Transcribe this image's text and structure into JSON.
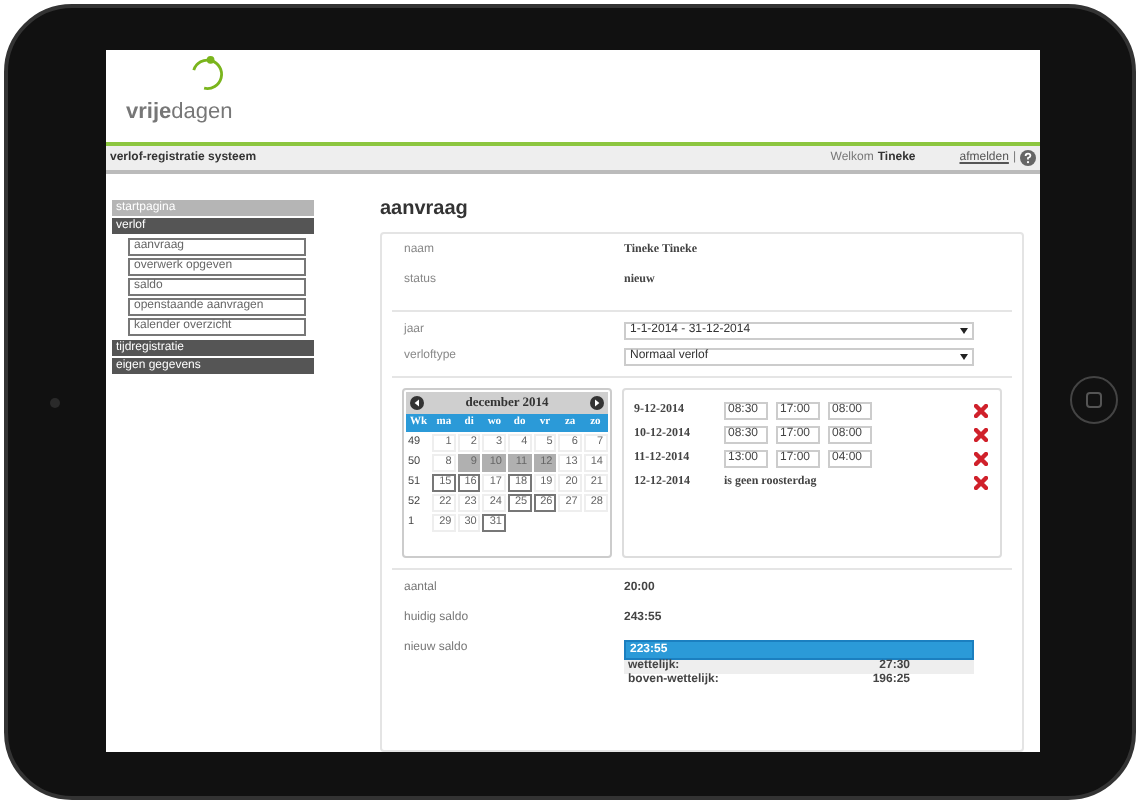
{
  "logo": "**vrije**dagen",
  "topbar": {
    "title": "verlof-registratie systeem",
    "welcome": "Welkom",
    "user": "Tineke",
    "logout": "afmelden",
    "separator": "|"
  },
  "sidebar": [
    {
      "label": "startpagina",
      "selected": true
    },
    {
      "label": "verlof",
      "selected": false,
      "expanded": true,
      "children": [
        {
          "label": "aanvraag"
        },
        {
          "label": "overwerk opgeven"
        },
        {
          "label": "saldo"
        },
        {
          "label": "openstaande aanvragen"
        },
        {
          "label": "kalender overzicht"
        }
      ]
    },
    {
      "label": "tijdregistratie",
      "selected": false
    },
    {
      "label": "eigen gegevens",
      "selected": false
    }
  ],
  "page_title": "aanvraag",
  "info": [
    {
      "label": "naam",
      "value": "Tineke Tineke"
    },
    {
      "label": "status",
      "value": "nieuw"
    }
  ],
  "selects": [
    {
      "label": "jaar",
      "value": "1-1-2014 - 31-12-2014"
    },
    {
      "label": "verloftype",
      "value": "Normaal verlof"
    }
  ],
  "calendar": {
    "month": "december 2014",
    "headers": [
      "Wk",
      "ma",
      "di",
      "wo",
      "do",
      "vr",
      "za",
      "zo"
    ],
    "weeks": [
      {
        "week": "49",
        "days": [
          {
            "day": "1"
          },
          {
            "day": "2"
          },
          {
            "day": "3"
          },
          {
            "day": "4"
          },
          {
            "day": "5"
          },
          {
            "day": "6"
          },
          {
            "day": "7"
          }
        ]
      },
      {
        "week": "50",
        "days": [
          {
            "day": "8"
          },
          {
            "day": "9",
            "selected": true
          },
          {
            "day": "10",
            "selected": true
          },
          {
            "day": "11",
            "selected": true
          },
          {
            "day": "12",
            "selected": true
          },
          {
            "day": "13"
          },
          {
            "day": "14"
          }
        ]
      },
      {
        "week": "51",
        "days": [
          {
            "day": "15",
            "outlined": true
          },
          {
            "day": "16",
            "outlined": true
          },
          {
            "day": "17"
          },
          {
            "day": "18",
            "outlined": true
          },
          {
            "day": "19"
          },
          {
            "day": "20"
          },
          {
            "day": "21"
          }
        ]
      },
      {
        "week": "52",
        "days": [
          {
            "day": "22"
          },
          {
            "day": "23"
          },
          {
            "day": "24"
          },
          {
            "day": "25",
            "outlined": true
          },
          {
            "day": "26",
            "outlined": true
          },
          {
            "day": "27"
          },
          {
            "day": "28"
          }
        ]
      },
      {
        "week": "1",
        "days": [
          {
            "day": "29"
          },
          {
            "day": "30"
          },
          {
            "day": "31",
            "outlined": true
          }
        ]
      }
    ]
  },
  "entries": [
    {
      "kind": "times",
      "date": "9-12-2014",
      "start": "08:30",
      "end": "17:00",
      "hours": "08:00"
    },
    {
      "kind": "times",
      "date": "10-12-2014",
      "start": "08:30",
      "end": "17:00",
      "hours": "08:00"
    },
    {
      "kind": "times",
      "date": "11-12-2014",
      "start": "13:00",
      "end": "17:00",
      "hours": "04:00"
    },
    {
      "kind": "note",
      "date": "12-12-2014",
      "note": "is geen roosterdag"
    }
  ],
  "totals": [
    {
      "label": "aantal",
      "value": "20:00"
    },
    {
      "label": "huidig saldo",
      "value": "243:55"
    }
  ],
  "new_balance": {
    "label": "nieuw saldo",
    "value": "223:55",
    "breakdown": [
      {
        "label": "wettelijk:",
        "value": "27:30"
      },
      {
        "label": "boven-wettelijk:",
        "value": "196:25"
      }
    ]
  }
}
